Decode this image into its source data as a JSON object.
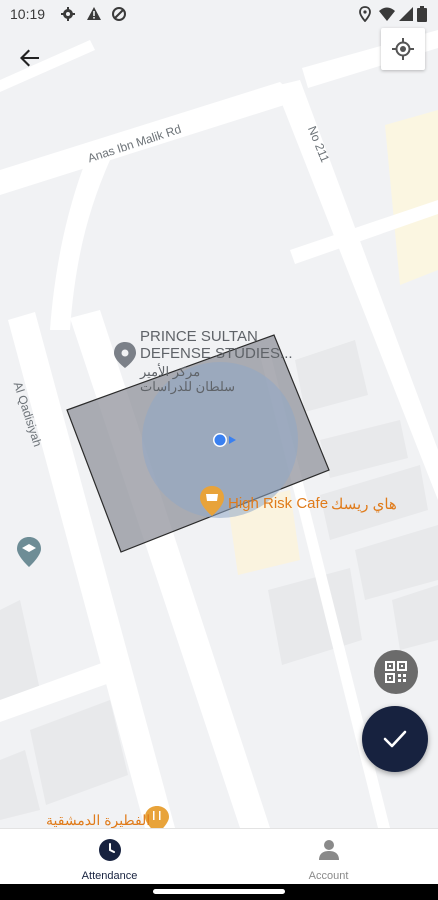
{
  "status_bar": {
    "time": "10:19",
    "left_icons": [
      "settings-icon",
      "warning-icon",
      "data-saver-icon"
    ],
    "right_icons": [
      "location-icon",
      "wifi-icon",
      "signal-icon",
      "battery-icon"
    ]
  },
  "map": {
    "roads": {
      "road_1": "Anas Ibn Malik Rd",
      "road_2": "No 211",
      "road_3": "Al Qadisiyah"
    },
    "pois": {
      "prince_sultan_en": "PRINCE SULTAN\nDEFENSE STUDIES...",
      "prince_sultan_ar": "مركز الأمير\nسلطان للدراسات",
      "cafe_en": "High Risk Cafe",
      "cafe_ar": "هاي ريسك",
      "restaurant_ar": "الفطيرة الدمشقية"
    },
    "colors": {
      "geofence_fill": "#8d8f99",
      "geofence_stroke": "#2b2b2b",
      "accuracy_circle": "#8fa7c6",
      "user_dot": "#3a80f0",
      "cafe_orange": "#e8a33a",
      "poi_gray": "#7b8088",
      "school_teal": "#6e8d96"
    }
  },
  "buttons": {
    "back": "arrow-back-icon",
    "my_location": "my-location-icon",
    "qr_scan": "qr-code-icon",
    "confirm": "check-icon"
  },
  "bottom_nav": {
    "attendance_label": "Attendance",
    "account_label": "Account"
  }
}
